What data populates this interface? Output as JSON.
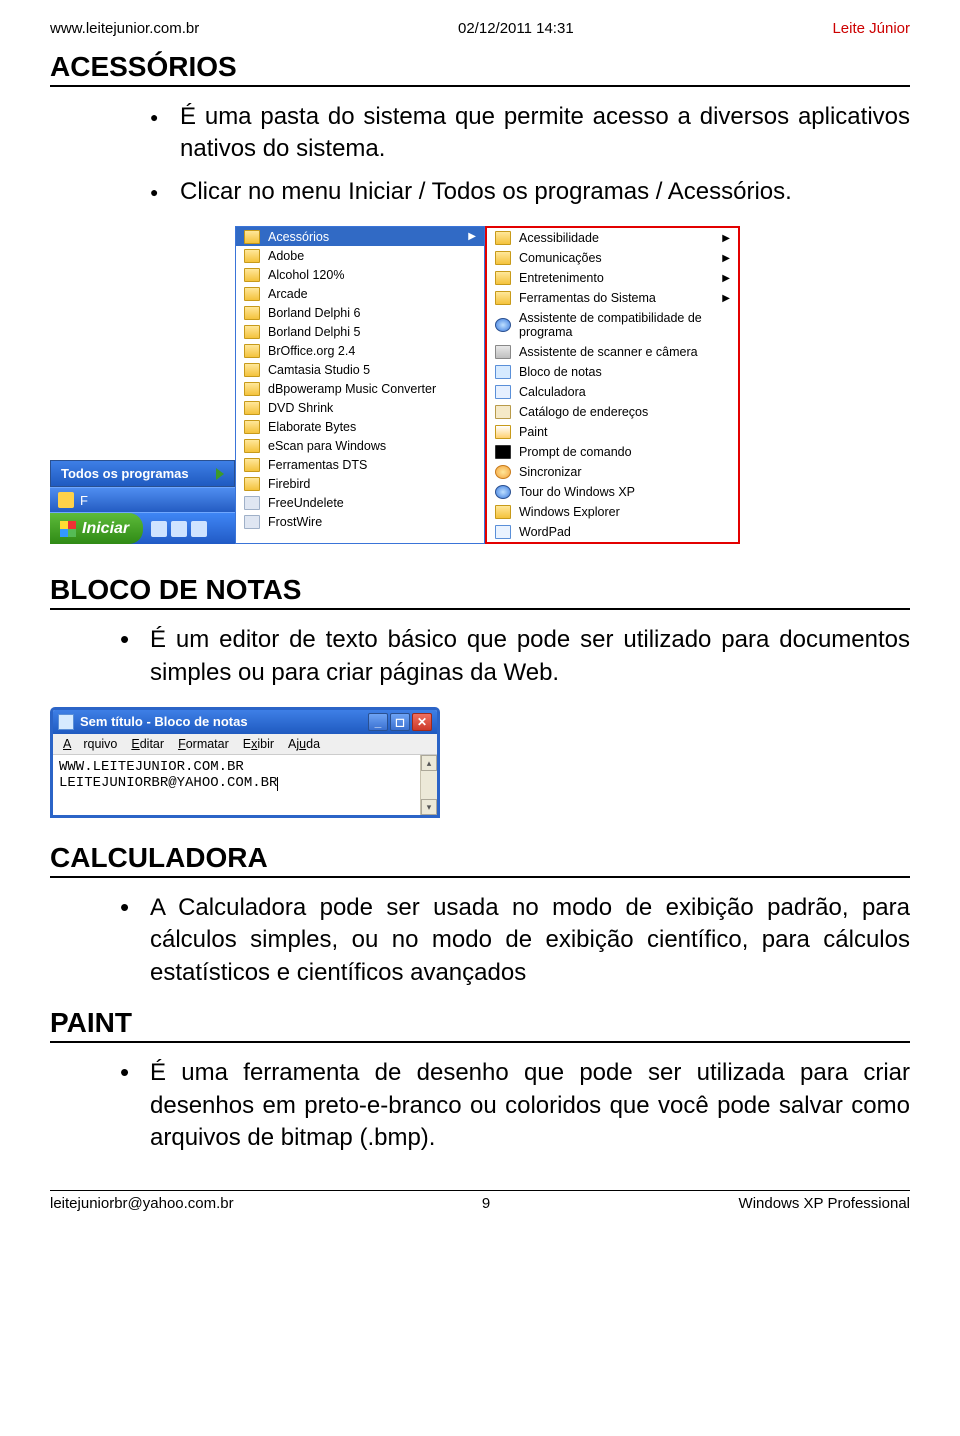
{
  "header": {
    "left": "www.leitejunior.com.br",
    "center": "02/12/2011 14:31",
    "right": "Leite Júnior"
  },
  "s_acessorios": {
    "title": "ACESSÓRIOS",
    "b1": "É uma pasta do sistema que permite acesso a diversos aplicativos nativos do sistema.",
    "b2": "Clicar no menu Iniciar / Todos os programas / Acessórios."
  },
  "menu": {
    "all_programs": "Todos os programas",
    "start": "Iniciar",
    "left": [
      "Acessórios",
      "Adobe",
      "Alcohol 120%",
      "Arcade",
      "Borland Delphi 6",
      "Borland Delphi 5",
      "BrOffice.org 2.4",
      "Camtasia Studio 5",
      "dBpoweramp Music Converter",
      "DVD Shrink",
      "Elaborate Bytes",
      "eScan para Windows",
      "Ferramentas DTS",
      "Firebird",
      "FreeUndelete",
      "FrostWire"
    ],
    "right": [
      {
        "l": "Acessibilidade",
        "t": "folder",
        "a": true
      },
      {
        "l": "Comunicações",
        "t": "folder",
        "a": true
      },
      {
        "l": "Entretenimento",
        "t": "folder",
        "a": true
      },
      {
        "l": "Ferramentas do Sistema",
        "t": "folder",
        "a": true
      },
      {
        "l": "Assistente de compatibilidade de programa",
        "t": "help"
      },
      {
        "l": "Assistente de scanner e câmera",
        "t": "scan"
      },
      {
        "l": "Bloco de notas",
        "t": "note"
      },
      {
        "l": "Calculadora",
        "t": "calc"
      },
      {
        "l": "Catálogo de endereços",
        "t": "addr"
      },
      {
        "l": "Paint",
        "t": "paint"
      },
      {
        "l": "Prompt de comando",
        "t": "cmd"
      },
      {
        "l": "Sincronizar",
        "t": "sync"
      },
      {
        "l": "Tour do Windows XP",
        "t": "tour"
      },
      {
        "l": "Windows Explorer",
        "t": "folder"
      },
      {
        "l": "WordPad",
        "t": "wpad"
      }
    ]
  },
  "s_bloco": {
    "title": "BLOCO DE NOTAS",
    "b1": "É um editor de texto básico que pode ser utilizado para documentos simples ou para criar páginas da Web."
  },
  "notepad": {
    "title": "Sem título - Bloco de notas",
    "menu": {
      "arquivo": "Arquivo",
      "editar": "Editar",
      "formatar": "Formatar",
      "exibir": "Exibir",
      "ajuda": "Ajuda"
    },
    "line1": "WWW.LEITEJUNIOR.COM.BR",
    "line2": "LEITEJUNIORBR@YAHOO.COM.BR"
  },
  "s_calc": {
    "title": "CALCULADORA",
    "b1": "A Calculadora pode ser usada no modo de exibição padrão, para cálculos simples, ou no modo de exibição científico, para cálculos estatísticos e científicos avançados"
  },
  "s_paint": {
    "title": "PAINT",
    "b1": "É uma ferramenta de desenho que pode ser utilizada para criar desenhos em preto-e-branco ou coloridos que você pode salvar como arquivos de bitmap (.bmp)."
  },
  "footer": {
    "left": "leitejuniorbr@yahoo.com.br",
    "center": "9",
    "right": "Windows XP Professional"
  }
}
